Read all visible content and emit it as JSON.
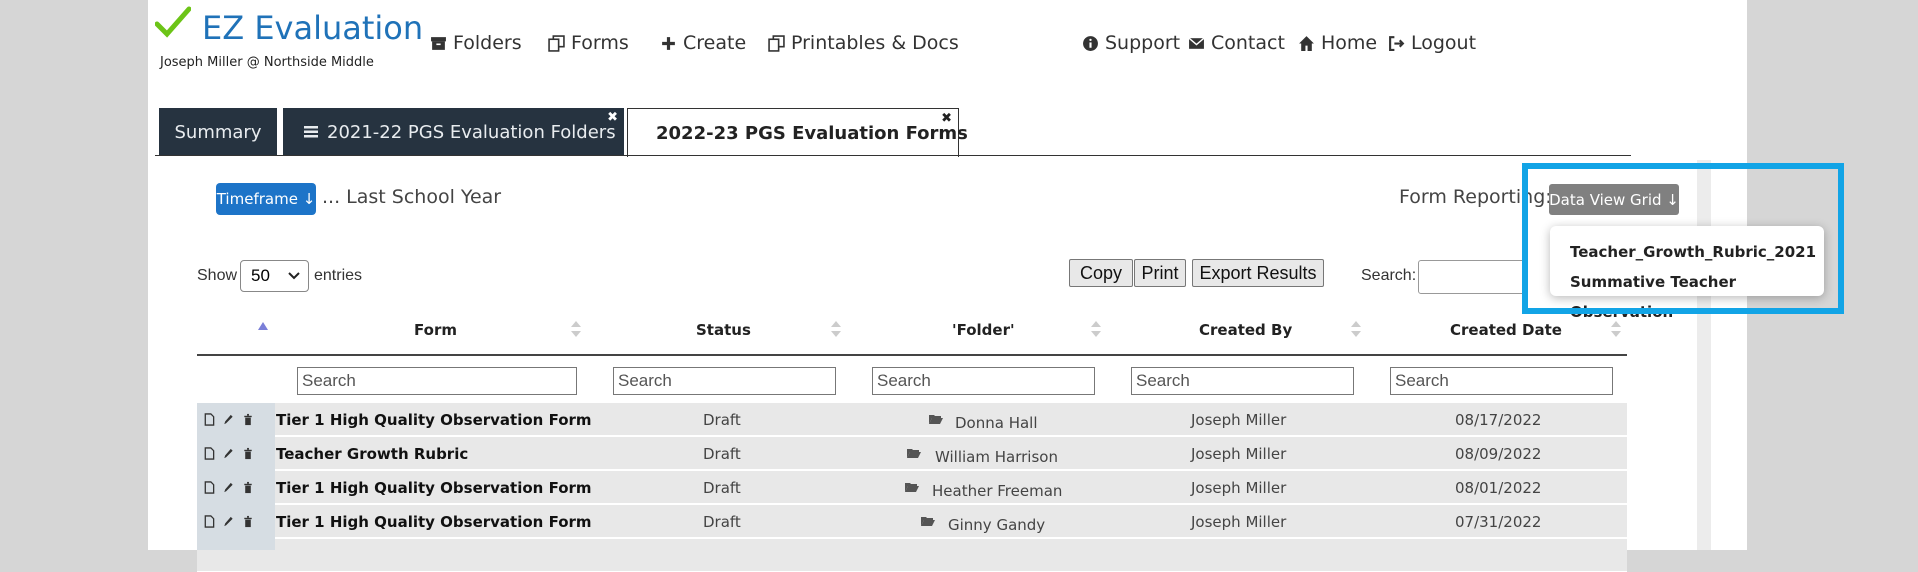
{
  "app": {
    "title": "EZ Evaluation",
    "subtitle": "Joseph Miller @ Northside Middle"
  },
  "nav": {
    "folders": "Folders",
    "forms": "Forms",
    "create": "Create",
    "printables": "Printables & Docs",
    "support": "Support",
    "contact": "Contact",
    "home": "Home",
    "logout": "Logout"
  },
  "tabs": [
    {
      "label": "Summary"
    },
    {
      "label": "2021-22 PGS Evaluation Folders"
    },
    {
      "label": "2022-23 PGS Evaluation Forms"
    }
  ],
  "toolbar": {
    "timeframe_button": "Timeframe ↓",
    "timeframe_value": "... Last School Year",
    "form_reporting_label": "Form Reporting:",
    "data_view_button": "Data View Grid ↓",
    "dropdown_items": [
      "Teacher_Growth_Rubric_2021",
      "Summative Teacher Observation"
    ],
    "show_label": "Show",
    "entries_value": "50",
    "entries_label": "entries",
    "copy": "Copy",
    "print": "Print",
    "export": "Export Results",
    "search_label": "Search:"
  },
  "table": {
    "columns": [
      "Form",
      "Status",
      "'Folder'",
      "Created By",
      "Created Date"
    ],
    "search_placeholder": "Search",
    "rows": [
      {
        "form": "Tier 1 High Quality Observation Form",
        "status": "Draft",
        "folder": "Donna Hall",
        "created_by": "Joseph Miller",
        "created_date": "08/17/2022"
      },
      {
        "form": "Teacher Growth Rubric",
        "status": "Draft",
        "folder": "William Harrison",
        "created_by": "Joseph Miller",
        "created_date": "08/09/2022"
      },
      {
        "form": "Tier 1 High Quality Observation Form",
        "status": "Draft",
        "folder": "Heather Freeman",
        "created_by": "Joseph Miller",
        "created_date": "08/01/2022"
      },
      {
        "form": "Tier 1 High Quality Observation Form",
        "status": "Draft",
        "folder": "Ginny Gandy",
        "created_by": "Joseph Miller",
        "created_date": "07/31/2022"
      }
    ]
  },
  "colors": {
    "brand_blue": "#1f72b8",
    "check_green": "#6cc417",
    "tab_dark": "#263340",
    "highlight": "#12a4e6"
  }
}
